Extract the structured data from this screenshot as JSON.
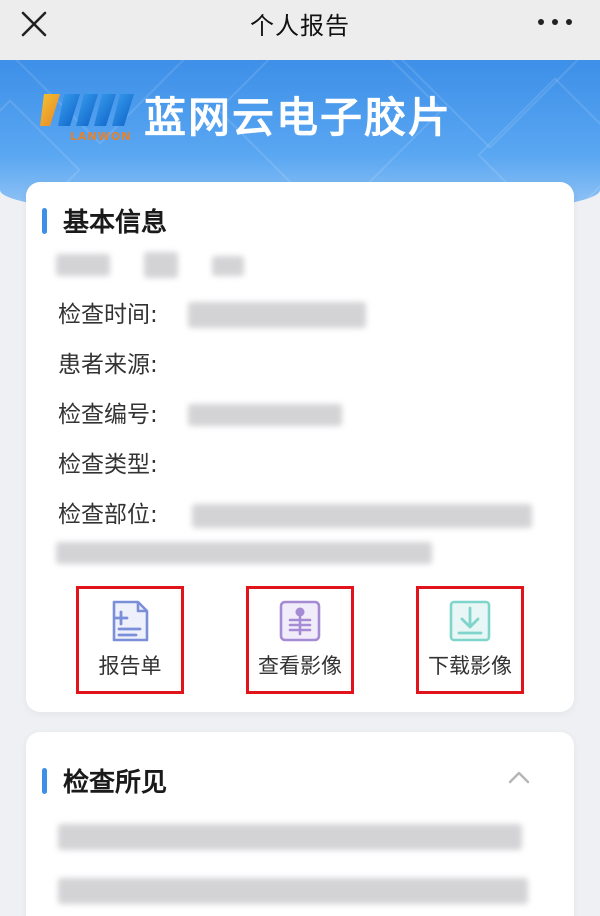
{
  "navbar": {
    "title": "个人报告"
  },
  "banner": {
    "logo_text": "LANWON",
    "brand_name": "蓝网云电子胶片"
  },
  "basic_info": {
    "section_title": "基本信息",
    "fields": [
      {
        "label": "检查时间:"
      },
      {
        "label": "患者来源:"
      },
      {
        "label": "检查编号:"
      },
      {
        "label": "检查类型:"
      },
      {
        "label": "检查部位:"
      }
    ]
  },
  "actions": [
    {
      "label": "报告单",
      "icon": "report-icon",
      "color": "#7b8fd9"
    },
    {
      "label": "查看影像",
      "icon": "view-image-icon",
      "color": "#a58ad4"
    },
    {
      "label": "下载影像",
      "icon": "download-icon",
      "color": "#7fd4cc"
    }
  ],
  "findings": {
    "section_title": "检查所见"
  },
  "colors": {
    "accent": "#3d8fe8",
    "highlight_border": "#e1141c"
  }
}
